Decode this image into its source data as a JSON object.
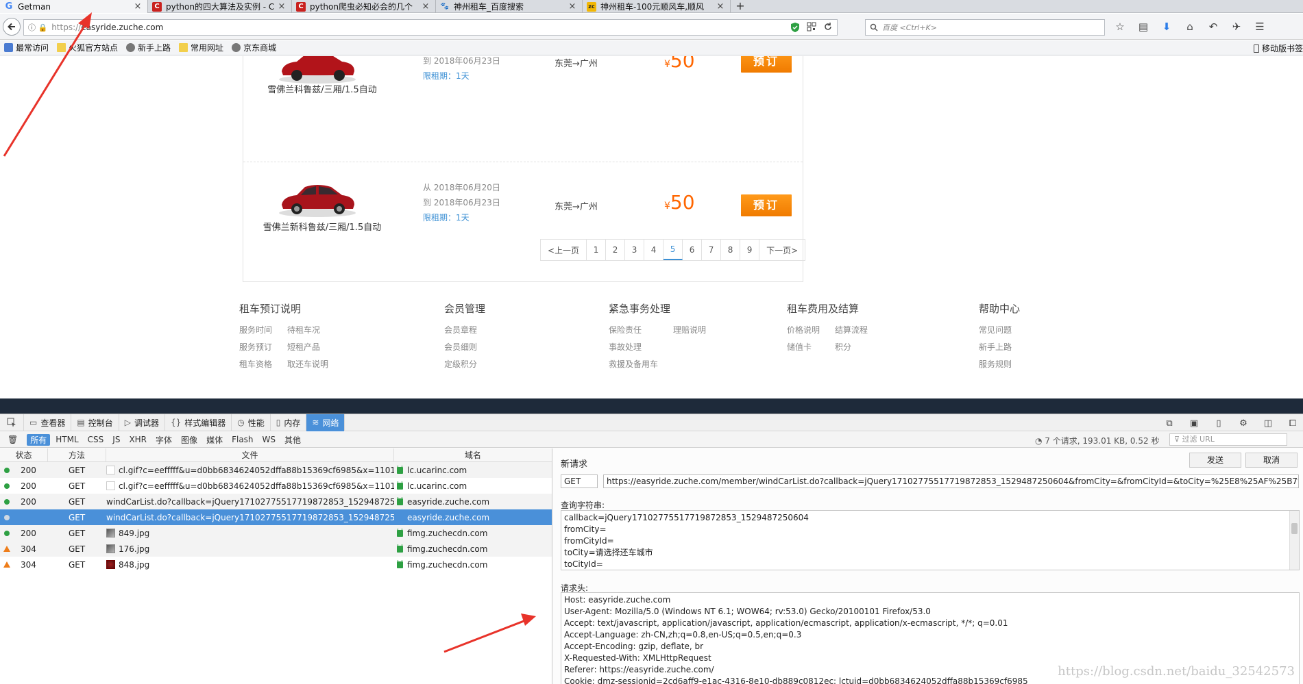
{
  "browser": {
    "tabs": [
      {
        "title": "Getman",
        "fav": "G"
      },
      {
        "title": "python的四大算法及实例 - C",
        "fav": "C"
      },
      {
        "title": "python爬虫必知必会的几个",
        "fav": "C"
      },
      {
        "title": "神州租车_百度搜索",
        "fav": "🐾"
      },
      {
        "title": "神州租车-100元顺风车,顺风",
        "fav": "zc"
      }
    ],
    "new_tab": "+",
    "close": "×",
    "url_scheme": "https://",
    "url_host": "easyride.zuche.com",
    "search_placeholder": "百度 <Ctrl+K>",
    "bookmarks": [
      "最常访问",
      "火狐官方站点",
      "新手上路",
      "常用网址",
      "京东商城"
    ],
    "mobile_bookmarks": "移动版书签"
  },
  "cars": [
    {
      "name": "雪佛兰科鲁兹/三厢/1.5自动",
      "date_from": "",
      "date_to": "到 2018年06月23日",
      "limit": "限租期：1天",
      "route": "东莞→广州",
      "currency": "¥",
      "price": "50",
      "button": "预订"
    },
    {
      "name": "雪佛兰新科鲁兹/三厢/1.5自动",
      "date_from": "从 2018年06月20日",
      "date_to": "到 2018年06月23日",
      "limit": "限租期：1天",
      "route": "东莞→广州",
      "currency": "¥",
      "price": "50",
      "button": "预订"
    }
  ],
  "pager": {
    "prev": "<上一页",
    "pages": [
      "1",
      "2",
      "3",
      "4",
      "5",
      "6",
      "7",
      "8",
      "9"
    ],
    "current": "5",
    "next": "下一页>"
  },
  "footer": [
    {
      "title": "租车预订说明",
      "links": [
        "服务时间",
        "待租车况",
        "服务预订",
        "短租产品",
        "租车资格",
        "取还车说明"
      ]
    },
    {
      "title": "会员管理",
      "links": [
        "会员章程",
        "会员细则",
        "定级积分"
      ]
    },
    {
      "title": "紧急事务处理",
      "links": [
        "保险责任",
        "理赔说明",
        "事故处理",
        "",
        "救援及备用车",
        ""
      ]
    },
    {
      "title": "租车费用及结算",
      "links": [
        "价格说明",
        "结算流程",
        "储值卡",
        "积分"
      ]
    },
    {
      "title": "帮助中心",
      "links": [
        "常见问题",
        "新手上路",
        "服务规则"
      ]
    }
  ],
  "devtools": {
    "tabs": [
      "查看器",
      "控制台",
      "调试器",
      "样式编辑器",
      "性能",
      "内存",
      "网络"
    ],
    "active_tab": "网络",
    "filters": [
      "所有",
      "HTML",
      "CSS",
      "JS",
      "XHR",
      "字体",
      "图像",
      "媒体",
      "Flash",
      "WS",
      "其他"
    ],
    "summary": "7 个请求, 193.01 KB, 0.52 秒",
    "url_filter_placeholder": "过滤 URL",
    "columns": [
      "状态",
      "方法",
      "文件",
      "域名"
    ],
    "requests": [
      {
        "status": "200",
        "method": "GET",
        "file": "cl.gif?c=eefffff&u=d0bb6834624052dffa88b15369cf6985&x=1101...",
        "domain": "lc.ucarinc.com"
      },
      {
        "status": "200",
        "method": "GET",
        "file": "cl.gif?c=eefffff&u=d0bb6834624052dffa88b15369cf6985&x=1101...",
        "domain": "lc.ucarinc.com"
      },
      {
        "status": "200",
        "method": "GET",
        "file": "windCarList.do?callback=jQuery17102775517719872853_1529487250...",
        "domain": "easyride.zuche.com"
      },
      {
        "status": "",
        "method": "GET",
        "file": "windCarList.do?callback=jQuery17102775517719872853_1529487250...",
        "domain": "easyride.zuche.com"
      },
      {
        "status": "200",
        "method": "GET",
        "file": "849.jpg",
        "domain": "fimg.zuchecdn.com"
      },
      {
        "status": "304",
        "method": "GET",
        "file": "176.jpg",
        "domain": "fimg.zuchecdn.com"
      },
      {
        "status": "304",
        "method": "GET",
        "file": "848.jpg",
        "domain": "fimg.zuchecdn.com"
      }
    ],
    "panel": {
      "title": "新请求",
      "send": "发送",
      "cancel": "取消",
      "method": "GET",
      "url": "https://easyride.zuche.com/member/windCarList.do?callback=jQuery17102775517719872853_1529487250604&fromCity=&fromCityId=&toCity=%25E8%25AF%25B7%25E",
      "query_label": "查询字符串:",
      "query_lines": [
        "callback=jQuery17102775517719872853_1529487250604",
        "fromCity=",
        "fromCityId=",
        "toCity=请选择还车城市",
        "toCityId="
      ],
      "headers_label": "请求头:",
      "header_lines": [
        "Host: easyride.zuche.com",
        "User-Agent: Mozilla/5.0 (Windows NT 6.1; WOW64; rv:53.0) Gecko/20100101 Firefox/53.0",
        "Accept: text/javascript, application/javascript, application/ecmascript, application/x-ecmascript, */*; q=0.01",
        "Accept-Language: zh-CN,zh;q=0.8,en-US;q=0.5,en;q=0.3",
        "Accept-Encoding: gzip, deflate, br",
        "X-Requested-With: XMLHttpRequest",
        "Referer: https://easyride.zuche.com/",
        "Cookie: dmz-sessionid=2cd6aff9-e1ac-4316-8e10-db889c0812ec; lctuid=d0bb6834624052dffa88b15369cf6985"
      ]
    }
  },
  "watermark": "https://blog.csdn.net/baidu_32542573",
  "colors": {
    "accent": "#4a90d9",
    "price": "#ff6600",
    "annotation": "#e8332a"
  }
}
